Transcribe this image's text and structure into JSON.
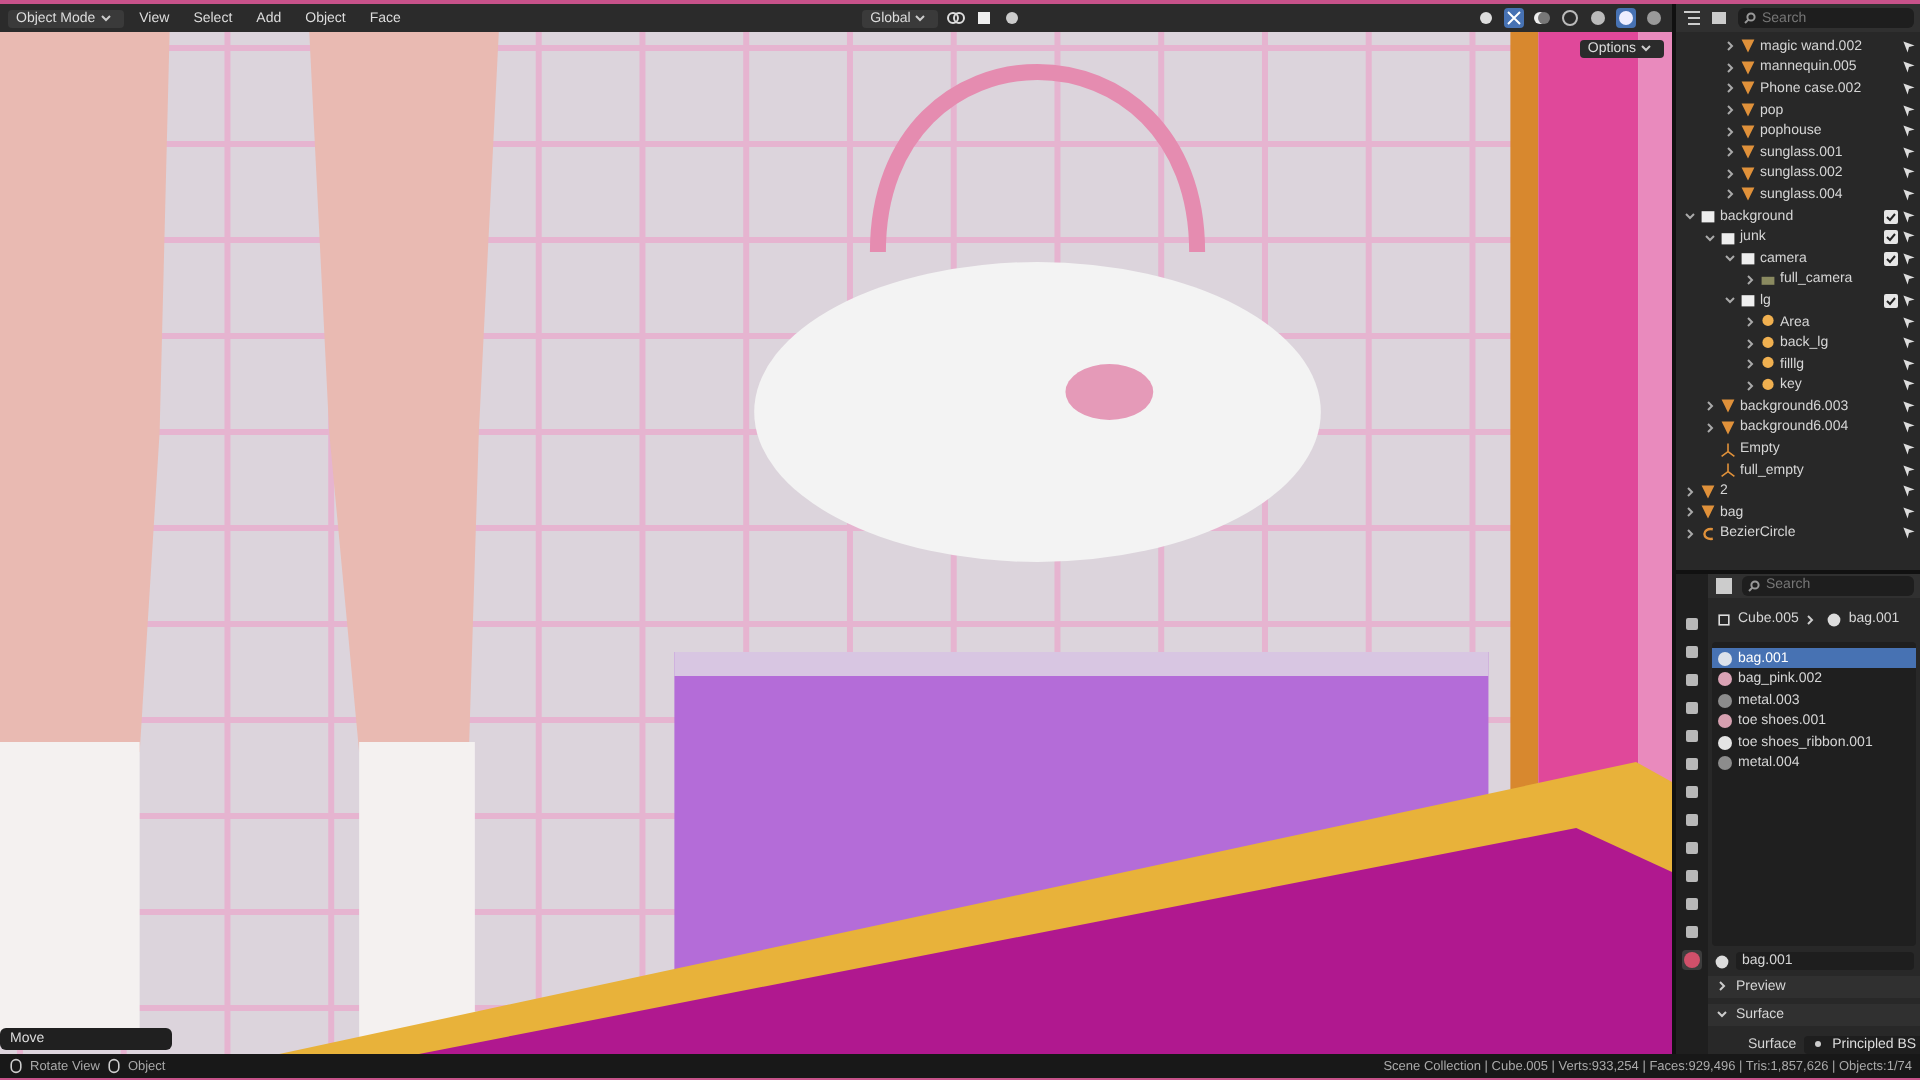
{
  "header": {
    "mode": "Object Mode",
    "menus": [
      "View",
      "Select",
      "Add",
      "Object",
      "Face"
    ],
    "orientation": "Global",
    "options": "Options"
  },
  "viewport": {
    "last_operator": "Move"
  },
  "outliner": {
    "search_placeholder": "Search",
    "clipped_items": [
      {
        "name": "magic wand.002",
        "kind": "mesh",
        "expanded": false
      },
      {
        "name": "mannequin.005",
        "kind": "mesh",
        "expanded": false
      },
      {
        "name": "Phone case.002",
        "kind": "mesh",
        "expanded": false
      },
      {
        "name": "pop",
        "kind": "mesh",
        "expanded": false
      },
      {
        "name": "pophouse",
        "kind": "mesh",
        "expanded": false
      },
      {
        "name": "sunglass.001",
        "kind": "mesh",
        "expanded": false
      },
      {
        "name": "sunglass.002",
        "kind": "mesh",
        "expanded": false
      },
      {
        "name": "sunglass.004",
        "kind": "mesh",
        "expanded": false
      }
    ],
    "tree": [
      {
        "name": "background",
        "kind": "collection",
        "expanded": true,
        "checked": true,
        "children": [
          {
            "name": "junk",
            "kind": "collection",
            "expanded": true,
            "checked": true,
            "children": [
              {
                "name": "camera",
                "kind": "collection",
                "expanded": true,
                "checked": true,
                "children": [
                  {
                    "name": "full_camera",
                    "kind": "camera",
                    "expanded": false
                  }
                ]
              },
              {
                "name": "lg",
                "kind": "collection",
                "expanded": true,
                "checked": true,
                "children": [
                  {
                    "name": "Area",
                    "kind": "light",
                    "expanded": false
                  },
                  {
                    "name": "back_lg",
                    "kind": "light",
                    "expanded": false
                  },
                  {
                    "name": "filllg",
                    "kind": "light",
                    "expanded": false
                  },
                  {
                    "name": "key",
                    "kind": "light",
                    "expanded": false
                  }
                ]
              }
            ]
          },
          {
            "name": "background6.003",
            "kind": "mesh",
            "expanded": false
          },
          {
            "name": "background6.004",
            "kind": "mesh",
            "expanded": false
          },
          {
            "name": "Empty",
            "kind": "empty"
          },
          {
            "name": "full_empty",
            "kind": "empty"
          }
        ]
      },
      {
        "name": "2",
        "kind": "mesh",
        "expanded": false
      },
      {
        "name": "bag",
        "kind": "mesh",
        "expanded": false
      },
      {
        "name": "BezierCircle",
        "kind": "curve",
        "expanded": false
      }
    ]
  },
  "properties": {
    "search_placeholder": "Search",
    "breadcrumb": [
      "Cube.005",
      "bag.001"
    ],
    "slots": [
      {
        "name": "bag.001",
        "color": "#dde2ea",
        "selected": true
      },
      {
        "name": "bag_pink.002",
        "color": "#d9a2b4",
        "selected": false
      },
      {
        "name": "metal.003",
        "color": "#8c8c8c",
        "selected": false
      },
      {
        "name": "toe shoes.001",
        "color": "#d6a0b0",
        "selected": false
      },
      {
        "name": "toe shoes_ribbon.001",
        "color": "#e4e4e4",
        "selected": false
      },
      {
        "name": "metal.004",
        "color": "#8c8c8c",
        "selected": false
      }
    ],
    "material_name": "bag.001",
    "panels": [
      {
        "title": "Preview",
        "expanded": false
      },
      {
        "title": "Surface",
        "expanded": true
      }
    ],
    "surface_label": "Surface",
    "surface_value": "Principled BS"
  },
  "status_bar": {
    "left": [
      "Rotate View",
      "Object"
    ],
    "right": "Scene Collection | Cube.005 | Verts:933,254 | Faces:929,496 | Tris:1,857,626 | Objects:1/74"
  }
}
